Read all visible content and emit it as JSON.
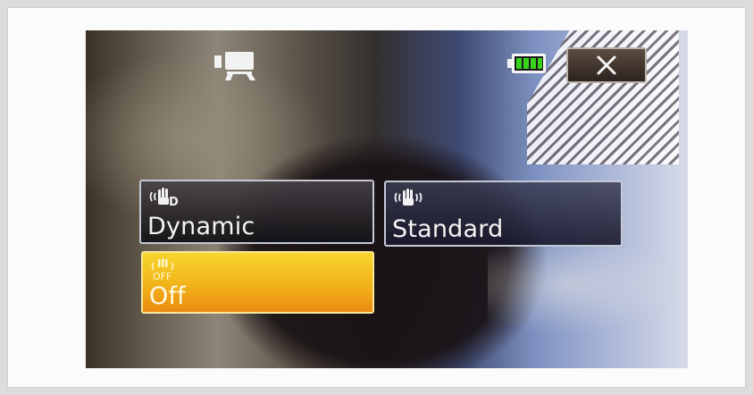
{
  "screen": {
    "battery_level": 1.0,
    "colors": {
      "selected_fill": "#f2b21a",
      "option_border": "#c3c8d3",
      "battery_green": "#38d41a"
    }
  },
  "options": [
    {
      "label": "Dynamic",
      "icon": "hand-shake-dynamic-icon",
      "selected": false
    },
    {
      "label": "Standard",
      "icon": "hand-shake-standard-icon",
      "selected": false
    },
    {
      "label": "Off",
      "icon": "hand-shake-off-icon",
      "selected": true
    }
  ],
  "icons": {
    "mode": "video-camera-icon",
    "battery": "battery-full-icon",
    "close": "close-icon"
  }
}
